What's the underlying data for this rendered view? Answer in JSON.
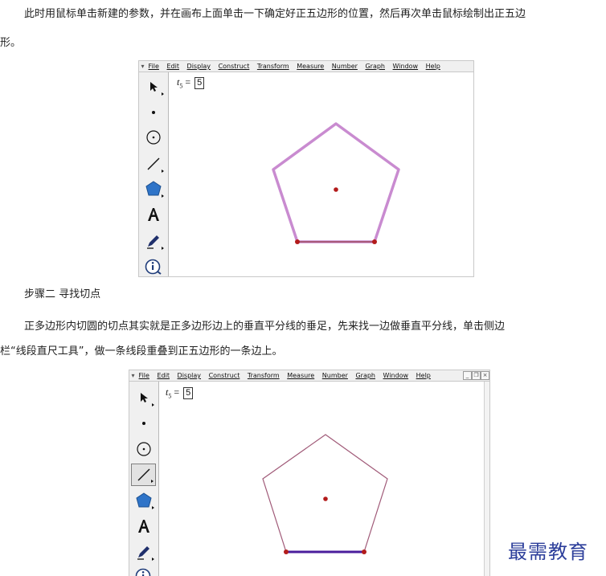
{
  "paragraphs": {
    "p1_line1": "此时用鼠标单击新建的参数，并在画布上面单击一下确定好正五边形的位置，然后再次单击鼠标绘制出正五边",
    "p1_line2": "形。",
    "step_heading": "步骤二 寻找切点",
    "p2_line1": "正多边形内切圆的切点其实就是正多边形边上的垂直平分线的垂足，先来找一边做垂直平分线，单击侧边",
    "p2_line2": "栏“线段直尺工具”，做一条线段重叠到正五边形的一条边上。"
  },
  "menu": [
    "File",
    "Edit",
    "Display",
    "Construct",
    "Transform",
    "Measure",
    "Number",
    "Graph",
    "Window",
    "Help"
  ],
  "window_controls": [
    "_",
    "❐",
    "×"
  ],
  "param": {
    "var": "t",
    "sub": "5",
    "eq": "=",
    "value": "5"
  },
  "tools": [
    "arrow-tool",
    "point-tool",
    "compass-tool",
    "straightedge-tool",
    "polygon-tool",
    "text-tool",
    "marker-tool",
    "info-tool"
  ],
  "colors": {
    "polygon_highlight": "#c98bd0",
    "polygon_edge": "#a05a78",
    "point": "#b31b1b",
    "selected_segment": "#4a1e9c",
    "watermark": "#2d3f9b"
  },
  "watermark": "最需教育"
}
